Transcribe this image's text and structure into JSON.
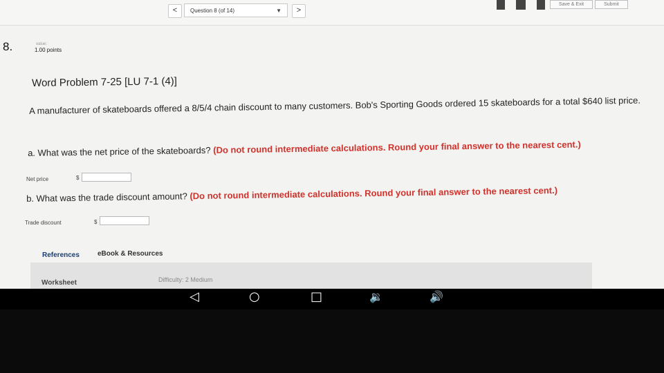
{
  "topbar": {
    "prev_label": "<",
    "question_select": "Question 8 (of 14)",
    "next_label": ">",
    "save_exit_label": "Save & Exit",
    "submit_label": "Submit"
  },
  "question": {
    "number": "8.",
    "value_label": "value:",
    "points": "1.00 points",
    "title": "Word Problem 7-25 [LU 7-1 (4)]",
    "prompt": "A manufacturer of skateboards offered a 8/5/4 chain discount to many customers. Bob's Sporting Goods ordered 15 skateboards for a total $640 list price.",
    "part_a": {
      "text": "a. What was the net price of the skateboards?",
      "warning": "(Do not round intermediate calculations. Round your final answer to the nearest cent.)",
      "field_label": "Net price",
      "currency": "$",
      "value": ""
    },
    "part_b": {
      "text": "b. What was the trade discount amount?",
      "warning": "(Do not round intermediate calculations. Round your final answer to the nearest cent.)",
      "field_label": "Trade discount",
      "currency": "$",
      "value": ""
    }
  },
  "tabs": [
    {
      "label": "References"
    },
    {
      "label": "eBook & Resources"
    }
  ],
  "footer": {
    "worksheet_label": "Worksheet",
    "difficulty": "Difficulty: 2 Medium"
  },
  "android_nav": {
    "back_icon": "back-triangle-icon",
    "home_icon": "home-circle-icon",
    "recents_icon": "recents-square-icon",
    "volume_down_icon": "volume-down-icon",
    "volume_up_icon": "volume-up-icon"
  },
  "colors": {
    "warning": "#d0322b",
    "tab_active": "#1b3f73",
    "page_bg": "#f3f3f1"
  }
}
